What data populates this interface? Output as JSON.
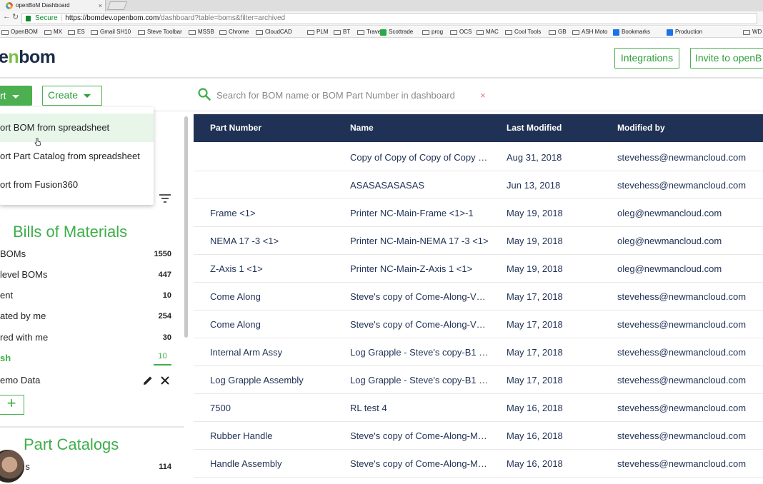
{
  "browser": {
    "tab_title": "openBoM Dashboard",
    "tab_close": "×",
    "secure_label": "Secure",
    "url_host": "https://bomdev.openbom.com",
    "url_path": "/dashboard?table=boms&filter=archived",
    "bookmarks": [
      "OpenBOM",
      "MX",
      "ES",
      "Gmail SH10",
      "Steve Toolbar",
      "MSSB",
      "Chrome",
      "CloudCAD",
      "PLM",
      "BT",
      "Travel",
      "Scottrade",
      "prog",
      "OCS",
      "MAC",
      "Cool Tools",
      "GB",
      "ASH Moto",
      "Bookmarks",
      "Production",
      "WD I"
    ]
  },
  "header": {
    "logo_prefix": "e",
    "logo_o": "n",
    "logo_rest": "bom",
    "integrations_label": "Integrations",
    "invite_label": "Invite to openB"
  },
  "toolbar": {
    "import_label": "rt",
    "create_label": "Create",
    "search_placeholder": "Search for BOM name or BOM Part Number in dashboard",
    "clear_glyph": "×"
  },
  "dropdown": {
    "items": [
      "ort BOM from spreadsheet",
      "ort Part Catalog from spreadsheet",
      "ort from Fusion360"
    ]
  },
  "sidebar": {
    "bom_title": "Bills of Materials",
    "bom_rows": [
      {
        "label": "BOMs",
        "count": "1550"
      },
      {
        "label": " level BOMs",
        "count": "447"
      },
      {
        "label": "ent",
        "count": "10"
      },
      {
        "label": "ated by me",
        "count": "254"
      },
      {
        "label": "red with me",
        "count": "30"
      },
      {
        "label": "sh",
        "count": "10"
      }
    ],
    "demo_label": "emo Data",
    "add_label": "+",
    "catalogs_title": "Part Catalogs",
    "catalog_rows": [
      {
        "label": "atalogs",
        "count": "114"
      }
    ]
  },
  "table": {
    "headers": [
      "Part Number",
      "Name",
      "Last Modified",
      "Modified by"
    ],
    "rows": [
      [
        "",
        "Copy of Copy of Copy of Copy …",
        "Aug 31, 2018",
        "stevehess@newmancloud.com"
      ],
      [
        "",
        "ASASASASASAS",
        "Jun 13, 2018",
        "stevehess@newmancloud.com"
      ],
      [
        "Frame <1>",
        "Printer NC-Main-Frame <1>-1",
        "May 19, 2018",
        "oleg@newmancloud.com"
      ],
      [
        "NEMA 17 -3 <1>",
        "Printer NC-Main-NEMA 17 -3 <1>",
        "May 19, 2018",
        "oleg@newmancloud.com"
      ],
      [
        "Z-Axis 1 <1>",
        "Printer NC-Main-Z-Axis 1 <1>",
        "May 19, 2018",
        "oleg@newmancloud.com"
      ],
      [
        "Come Along",
        "Steve's copy of Come-Along-V…",
        "May 17, 2018",
        "stevehess@newmancloud.com"
      ],
      [
        "Come Along",
        "Steve's copy of Come-Along-V…",
        "May 17, 2018",
        "stevehess@newmancloud.com"
      ],
      [
        "Internal Arm Assy",
        "Log Grapple - Steve's copy-B1 …",
        "May 17, 2018",
        "stevehess@newmancloud.com"
      ],
      [
        "Log Grapple Assembly",
        "Log Grapple - Steve's copy-B1 …",
        "May 17, 2018",
        "stevehess@newmancloud.com"
      ],
      [
        "7500",
        "RL test 4",
        "May 16, 2018",
        "stevehess@newmancloud.com"
      ],
      [
        "Rubber Handle",
        "Steve's copy of Come-Along-M…",
        "May 16, 2018",
        "stevehess@newmancloud.com"
      ],
      [
        "Handle Assembly",
        "Steve's copy of Come-Along-M…",
        "May 16, 2018",
        "stevehess@newmancloud.com"
      ]
    ]
  },
  "colors": {
    "brand_green": "#3fae49",
    "table_header": "#1f3154"
  }
}
